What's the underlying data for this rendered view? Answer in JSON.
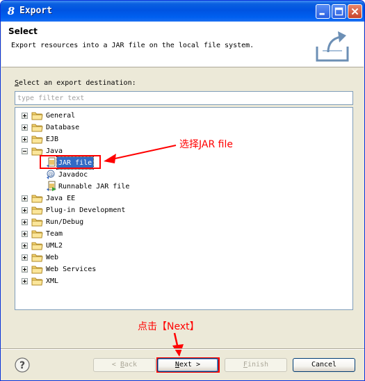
{
  "window": {
    "title": "Export",
    "title_icon": "eclipse-icon"
  },
  "header": {
    "title": "Select",
    "description": "Export resources into a JAR file on the local file system."
  },
  "filter": {
    "label_prefix": "S",
    "label_rest": "elect an export destination:",
    "placeholder": "type filter text"
  },
  "tree": {
    "items": [
      {
        "label": "General",
        "expanded": false,
        "depth": 0
      },
      {
        "label": "Database",
        "expanded": false,
        "depth": 0
      },
      {
        "label": "EJB",
        "expanded": false,
        "depth": 0
      },
      {
        "label": "Java",
        "expanded": true,
        "depth": 0
      },
      {
        "label": "JAR file",
        "depth": 1,
        "selected": true,
        "icon": "jar-file-icon"
      },
      {
        "label": "Javadoc",
        "depth": 1,
        "icon": "javadoc-icon"
      },
      {
        "label": "Runnable JAR file",
        "depth": 1,
        "icon": "runnable-jar-icon"
      },
      {
        "label": "Java EE",
        "expanded": false,
        "depth": 0
      },
      {
        "label": "Plug-in Development",
        "expanded": false,
        "depth": 0
      },
      {
        "label": "Run/Debug",
        "expanded": false,
        "depth": 0
      },
      {
        "label": "Team",
        "expanded": false,
        "depth": 0
      },
      {
        "label": "UML2",
        "expanded": false,
        "depth": 0
      },
      {
        "label": "Web",
        "expanded": false,
        "depth": 0
      },
      {
        "label": "Web Services",
        "expanded": false,
        "depth": 0
      },
      {
        "label": "XML",
        "expanded": false,
        "depth": 0
      }
    ]
  },
  "annotations": {
    "select_jar": "选择JAR file",
    "click_next": "点击【Next】",
    "color": "#ff0000"
  },
  "buttons": {
    "back_mnemonic": "B",
    "back_prefix": "< ",
    "back_rest": "ack",
    "next_mnemonic": "N",
    "next_rest": "ext >",
    "finish_mnemonic": "F",
    "finish_rest": "inish",
    "cancel": "Cancel"
  },
  "colors": {
    "titlebar": "#0053e1",
    "selection": "#316ac5",
    "dialog_bg": "#ece9d8"
  }
}
